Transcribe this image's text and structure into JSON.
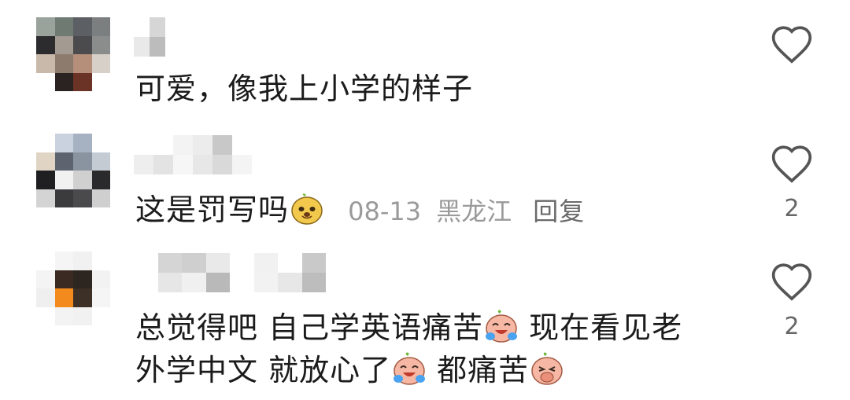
{
  "comments": [
    {
      "text": "可爱，像我上小学的样子",
      "likes": ""
    },
    {
      "text": "这是罚写吗",
      "emoji": "smug-face-emoji",
      "date": "08-13",
      "location": "黑龙江",
      "reply_label": "回复",
      "likes": "2"
    },
    {
      "line1": "总觉得吧 自己学英语痛苦",
      "line1_tail": "现在看见老",
      "line2_a": "外学中文 就放心了",
      "line2_b": "都痛苦",
      "likes": "2"
    }
  ],
  "icons": {
    "like": "heart-outline-icon",
    "emoji_cry": "crying-laugh-emoji",
    "emoji_smug": "smug-face-emoji",
    "emoji_cover_mouth": "cover-mouth-emoji"
  },
  "colors": {
    "text": "#1b1b1b",
    "meta": "#9a9a9a",
    "icon": "#555555"
  }
}
